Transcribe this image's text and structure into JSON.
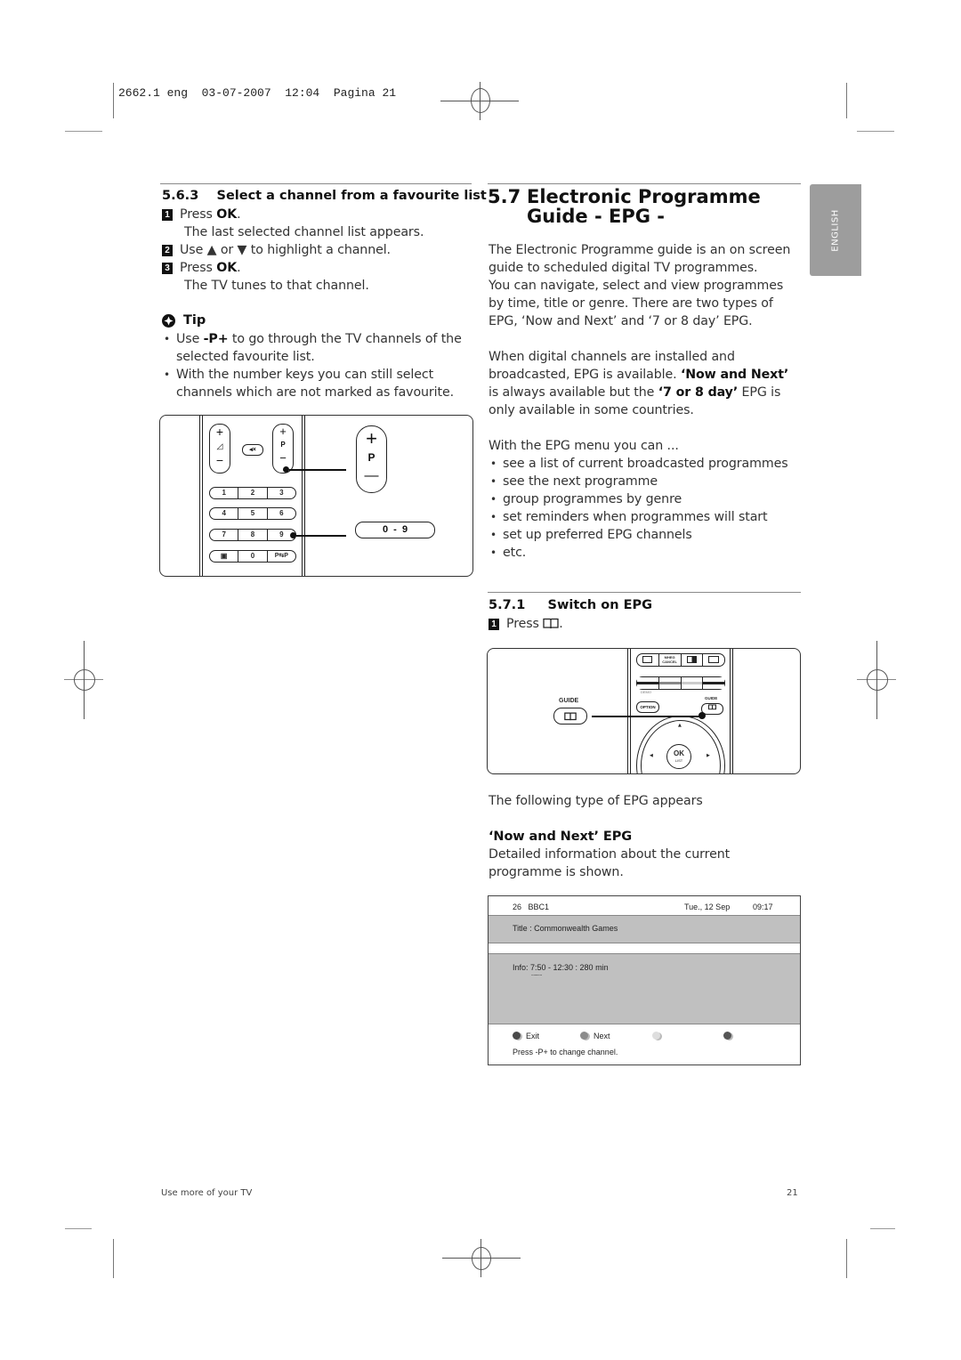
{
  "print_header": {
    "text": "2662.1 eng  03-07-2007  12:04  Pagina 21"
  },
  "left_column": {
    "section_number": "5.6.3",
    "section_title": "Select a channel from a favourite list",
    "steps": [
      {
        "num": "1",
        "text_before": "Press ",
        "bold": "OK",
        "text_after": ".",
        "result": "The last selected channel list appears."
      },
      {
        "num": "2",
        "text": "Use ▲ or ▼ to highlight a channel."
      },
      {
        "num": "3",
        "text_before": "Press ",
        "bold": "OK",
        "text_after": ".",
        "result": "The TV tunes to that channel."
      }
    ],
    "tip": {
      "label": "Tip",
      "items": [
        {
          "before": "Use ",
          "bold": "-P+",
          "after": " to go through the TV channels of the selected favourite list."
        },
        {
          "text": "With the number keys you can still select channels which are not marked as favourite."
        }
      ]
    },
    "remote_illustration": {
      "volume_plus": "+",
      "volume_minus": "−",
      "mute_icon": "mute-icon",
      "program_plus": "+",
      "program_label": "P",
      "program_minus": "−",
      "number_rows": [
        [
          "1",
          "2",
          "3"
        ],
        [
          "4",
          "5",
          "6"
        ],
        [
          "7",
          "8",
          "9"
        ],
        [
          "▣",
          "0",
          "P⇆P"
        ]
      ],
      "callout_program": {
        "plus": "+",
        "label": "P",
        "minus": "—"
      },
      "callout_digits": "0  -  9"
    }
  },
  "right_column": {
    "section_number": "5.7",
    "section_title_line1": "Electronic Programme",
    "section_title_line2": "Guide - EPG -",
    "intro_p1": "The Electronic Programme guide is an on screen guide to scheduled digital TV programmes.",
    "intro_p2": "You can navigate, select and view programmes by time, title or genre. There are two types of EPG, ‘Now and Next’ and ‘7 or 8 day’ EPG.",
    "avail": {
      "a": "When digital channels are installed and broadcasted, EPG is available. ",
      "b_bold": "‘Now and Next’",
      "c": " is always available but the ",
      "d_bold": "‘7 or 8 day’",
      "e": " EPG is only available in some countries."
    },
    "menu_intro": "With the EPG menu you can ...",
    "menu_items": [
      "see a list of current broadcasted programmes",
      "see the next programme",
      "group programmes by genre",
      "set reminders when programmes will start",
      "set up preferred EPG channels",
      "etc."
    ],
    "subsection_number": "5.7.1",
    "subsection_title": "Switch on EPG",
    "switch_step": {
      "num": "1",
      "text": "Press",
      "icon": "guide-book-icon"
    },
    "remote_illustration": {
      "guide_label": "GUIDE",
      "mheg_label": "MHEG\nCANCEL",
      "demo_label": "DEMO",
      "option_label": "OPTION",
      "guide_small_label": "GUIDE",
      "ok_label": "OK",
      "list_label": "LIST"
    },
    "following_text": "The following type of EPG appears",
    "now_next_heading": "‘Now and Next’ EPG",
    "now_next_desc": "Detailed information about the current programme is shown.",
    "epg_screen": {
      "channel": "26   BBC1",
      "date": "Tue., 12 Sep",
      "time": "09:17",
      "title_line": "Title : Commonwealth Games",
      "info_line": "Info: 7:50 - 12:30 : 280 min",
      "info_more": "..........",
      "buttons": [
        {
          "label": "Exit",
          "color": "#4a4a4a"
        },
        {
          "label": "Next",
          "color": "#8c8c8c"
        },
        {
          "label": "",
          "color": "#dedede"
        },
        {
          "label": "",
          "color": "#555555"
        }
      ],
      "footer": "Press -P+ to change channel."
    }
  },
  "language_tab": "ENGLISH",
  "footer": {
    "left": "Use more of your TV",
    "page_number": "21"
  }
}
